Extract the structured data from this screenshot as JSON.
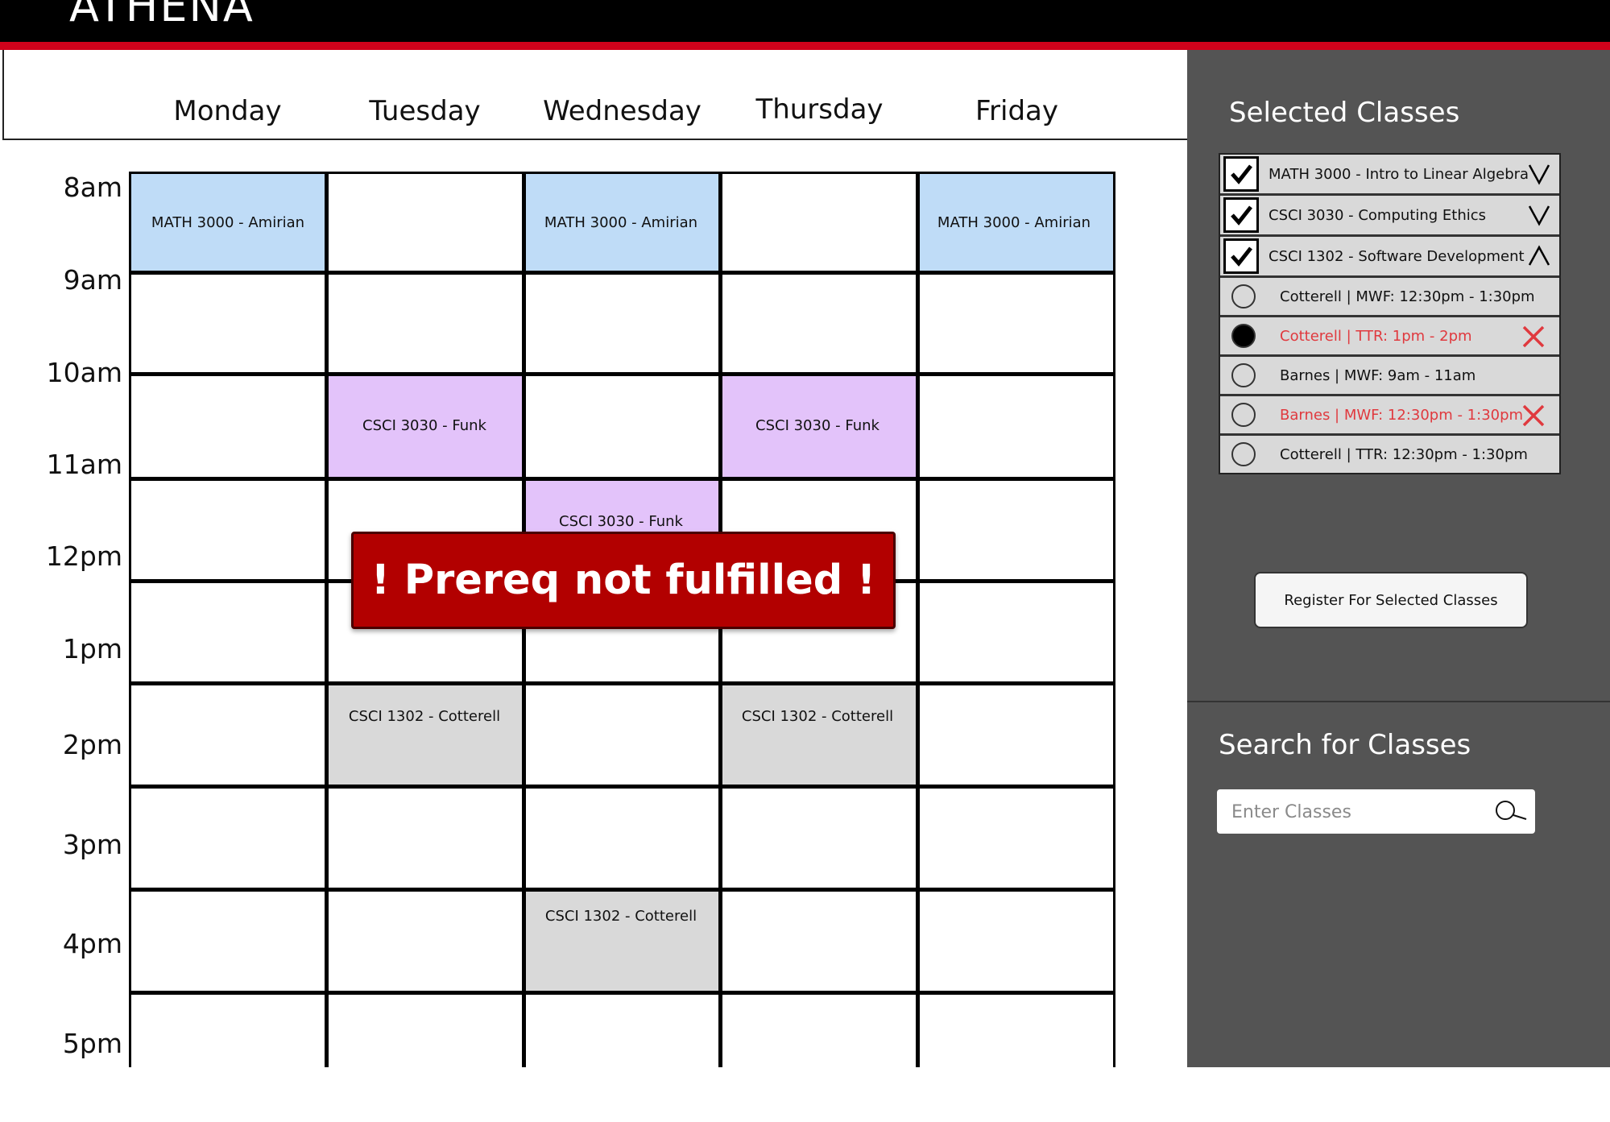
{
  "app": {
    "brand": "ATHENA"
  },
  "calendar": {
    "days": [
      "Monday",
      "Tuesday",
      "Wednesday",
      "Thursday",
      "Friday"
    ],
    "times": [
      "8am",
      "9am",
      "10am",
      "11am",
      "12pm",
      "1pm",
      "2pm",
      "3pm",
      "4pm",
      "5pm"
    ],
    "events": {
      "math_mon": "MATH 3000 - Amirian",
      "math_wed": "MATH 3000 - Amirian",
      "math_fri": "MATH 3000 - Amirian",
      "ethics_tue": "CSCI 3030 - Funk",
      "ethics_thu": "CSCI 3030 - Funk",
      "ethics_wed": "CSCI 3030 - Funk",
      "dev_tue": "CSCI 1302 - Cotterell",
      "dev_thu": "CSCI 1302 - Cotterell",
      "dev_wed": "CSCI 1302 - Cotterell"
    },
    "alert": "! Prereq not fulfilled !"
  },
  "selected": {
    "title": "Selected Classes",
    "courses": [
      {
        "label": "MATH 3000 - Intro to Linear Algebra",
        "checked": true,
        "expanded": false
      },
      {
        "label": "CSCI 3030 - Computing Ethics",
        "checked": true,
        "expanded": false
      },
      {
        "label": "CSCI 1302 - Software Development",
        "checked": true,
        "expanded": true
      }
    ],
    "sections": [
      {
        "label": "Cotterell | MWF: 12:30pm - 1:30pm",
        "selected": false,
        "conflict": false
      },
      {
        "label": "Cotterell | TTR: 1pm - 2pm",
        "selected": true,
        "conflict": true
      },
      {
        "label": "Barnes | MWF: 9am - 11am",
        "selected": false,
        "conflict": false
      },
      {
        "label": "Barnes | MWF: 12:30pm - 1:30pm",
        "selected": false,
        "conflict": true
      },
      {
        "label": "Cotterell | TTR: 12:30pm - 1:30pm",
        "selected": false,
        "conflict": false
      }
    ],
    "register_label": "Register For Selected Classes"
  },
  "search": {
    "title": "Search for Classes",
    "placeholder": "Enter Classes"
  },
  "colors": {
    "header": "#000000",
    "accent_red": "#d0021b",
    "alert_red": "#b20000",
    "math": "#bfdcf7",
    "ethics": "#e3c3fa",
    "dev": "#d9d9d9",
    "panel": "#545454",
    "conflict_text": "#e0393e"
  },
  "icons": [
    "checkbox-checked-icon",
    "chevron-down-icon",
    "chevron-up-icon",
    "radio-icon",
    "close-x-icon",
    "search-icon"
  ]
}
